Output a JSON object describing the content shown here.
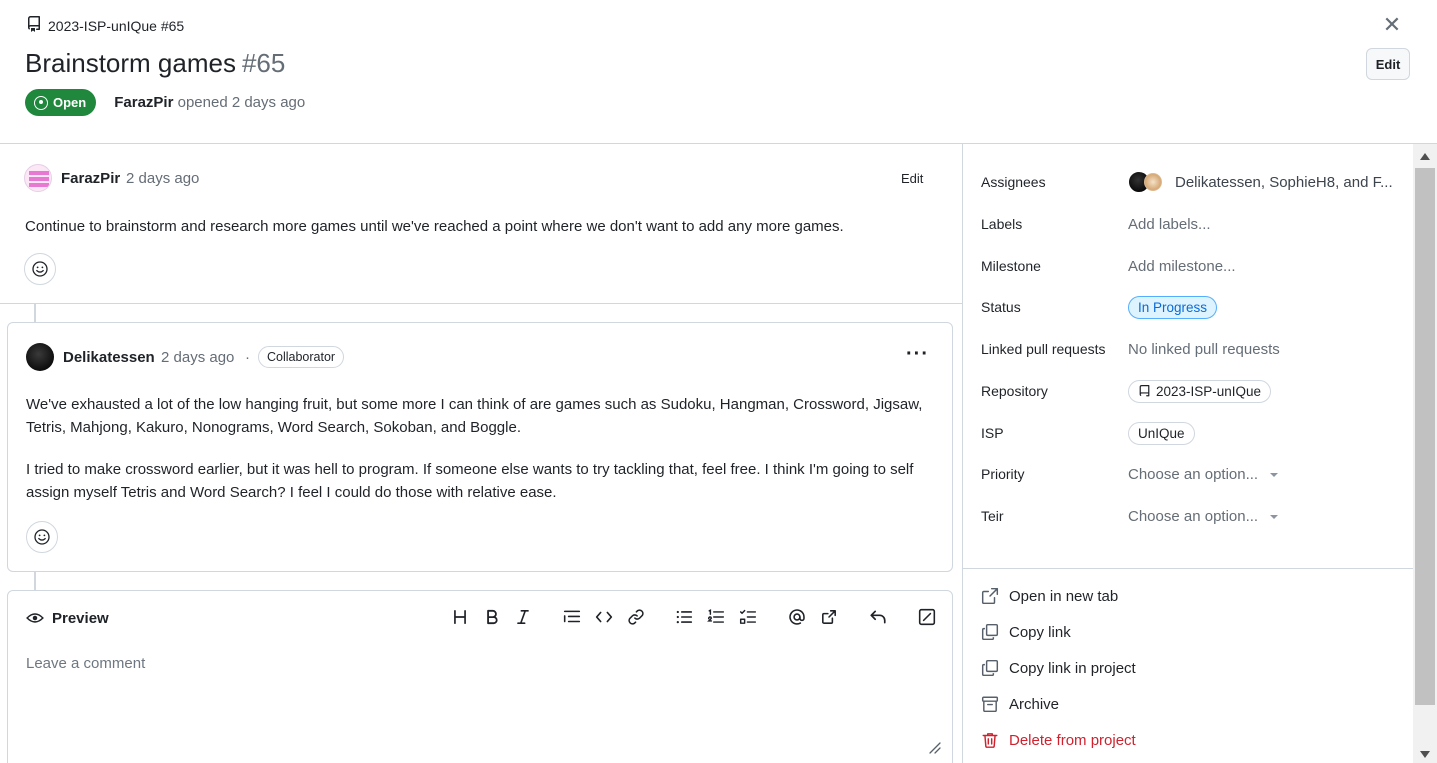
{
  "header": {
    "repo_ref": "2023-ISP-unIQue #65",
    "title": "Brainstorm games",
    "number": "#65",
    "state": "Open",
    "author": "FarazPir",
    "opened_text": "opened 2 days ago",
    "edit_label": "Edit",
    "close_icon": "close-icon"
  },
  "first_comment": {
    "author": "FarazPir",
    "time": "2 days ago",
    "edit_label": "Edit",
    "body": "Continue to brainstorm and research more games until we've reached a point where we don't want to add any more games."
  },
  "second_comment": {
    "author": "Delikatessen",
    "time": "2 days ago",
    "separator": "·",
    "role": "Collaborator",
    "more": "···",
    "paragraphs": [
      "We've exhausted a lot of the low hanging fruit, but some more I can think of are games such as Sudoku, Hangman, Crossword, Jigsaw, Tetris, Mahjong, Kakuro, Nonograms, Word Search, Sokoban, and Boggle.",
      "I tried to make crossword earlier, but it was hell to program. If someone else wants to try tackling that, feel free. I think I'm going to self assign myself Tetris and Word Search? I feel I could do those with relative ease."
    ]
  },
  "editor": {
    "preview_label": "Preview",
    "placeholder": "Leave a comment",
    "toolbar": [
      "heading",
      "bold",
      "italic",
      "quote",
      "code",
      "link",
      "bulleted-list",
      "numbered-list",
      "task-list",
      "mention",
      "reference",
      "undo",
      "fullscreen"
    ]
  },
  "sidebar": {
    "fields": [
      {
        "label": "Assignees",
        "value": "Delikatessen, SophieH8, and F..."
      },
      {
        "label": "Labels",
        "value": "Add labels..."
      },
      {
        "label": "Milestone",
        "value": "Add milestone..."
      },
      {
        "label": "Status",
        "value": "In Progress"
      },
      {
        "label": "Linked pull requests",
        "value": "No linked pull requests"
      },
      {
        "label": "Repository",
        "value": "2023-ISP-unIQue"
      },
      {
        "label": "ISP",
        "value": "UnIQue"
      },
      {
        "label": "Priority",
        "value": "Choose an option..."
      },
      {
        "label": "Teir",
        "value": "Choose an option..."
      }
    ],
    "actions": [
      {
        "label": "Open in new tab"
      },
      {
        "label": "Copy link"
      },
      {
        "label": "Copy link in project"
      },
      {
        "label": "Archive"
      },
      {
        "label": "Delete from project"
      }
    ]
  },
  "colors": {
    "open_green": "#1f883d",
    "status_blue": "#0969da",
    "danger_red": "#cf222e",
    "border": "#d0d7de"
  }
}
